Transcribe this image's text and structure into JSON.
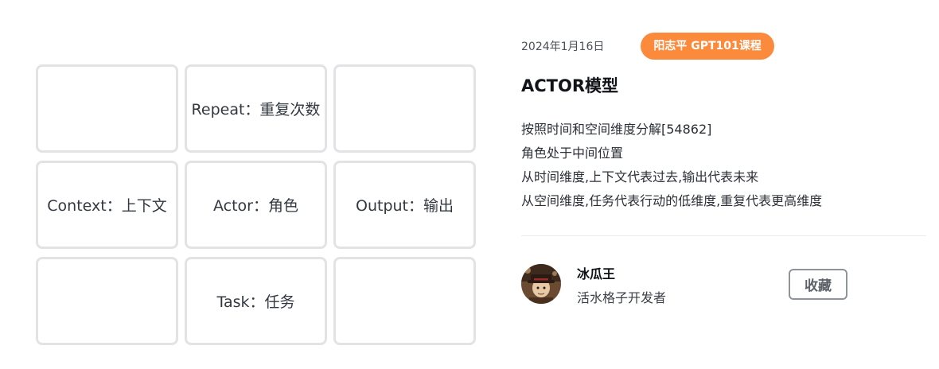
{
  "grid": {
    "cells": [
      "",
      "Repeat：重复次数",
      "",
      "Context：上下文",
      "Actor：角色",
      "Output：输出",
      "",
      "Task：任务",
      ""
    ]
  },
  "post": {
    "date": "2024年1月16日",
    "tag": "阳志平 GPT101课程",
    "title": "ACTOR模型",
    "description": [
      "按照时间和空间维度分解[54862]",
      "角色处于中间位置",
      "从时间维度,上下文代表过去,输出代表未来",
      "从空间维度,任务代表行动的低维度,重复代表更高维度"
    ]
  },
  "author": {
    "name": "冰瓜王",
    "subtitle": "活水格子开发者"
  },
  "actions": {
    "favorite_label": "收藏"
  },
  "colors": {
    "tag_bg": "#fb8a3c",
    "cell_border": "#e3e3e6"
  }
}
